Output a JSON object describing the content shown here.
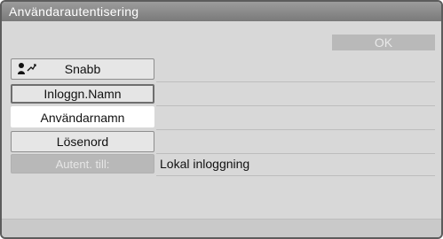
{
  "window": {
    "title": "Användarautentisering"
  },
  "toolbar": {
    "ok_label": "OK"
  },
  "buttons": {
    "quick": "Snabb",
    "login_name": "Inloggn.Namn",
    "username": "Användarnamn",
    "password": "Lösenord",
    "auth_to": "Autent. till:"
  },
  "fields": {
    "auth_to_value": "Lokal inloggning"
  },
  "icons": {
    "quick": "user-quick-icon"
  }
}
